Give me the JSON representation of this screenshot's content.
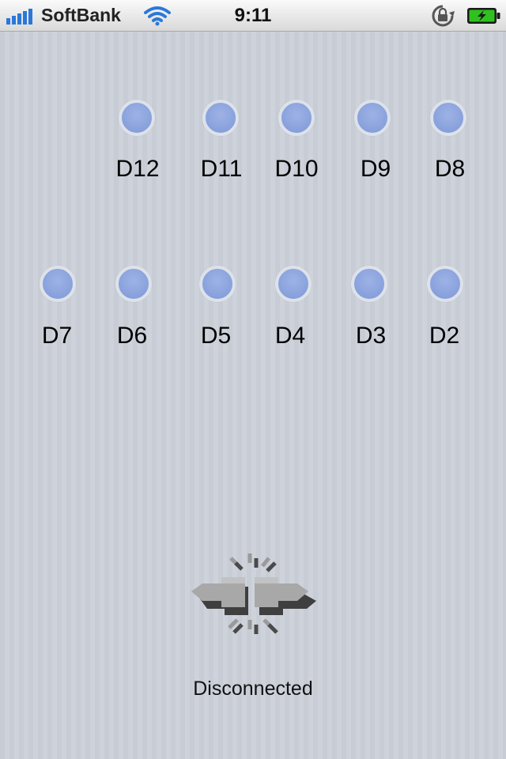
{
  "status_bar": {
    "carrier": "SoftBank",
    "time": "9:11"
  },
  "pins_row1": [
    "D12",
    "D11",
    "D10",
    "D9",
    "D8"
  ],
  "pins_row2": [
    "D7",
    "D6",
    "D5",
    "D4",
    "D3",
    "D2"
  ],
  "connection": {
    "status": "Disconnected",
    "icon": "disconnected-plug-icon"
  },
  "colors": {
    "led": "#8ba3dd",
    "battery": "#2fc21f"
  }
}
